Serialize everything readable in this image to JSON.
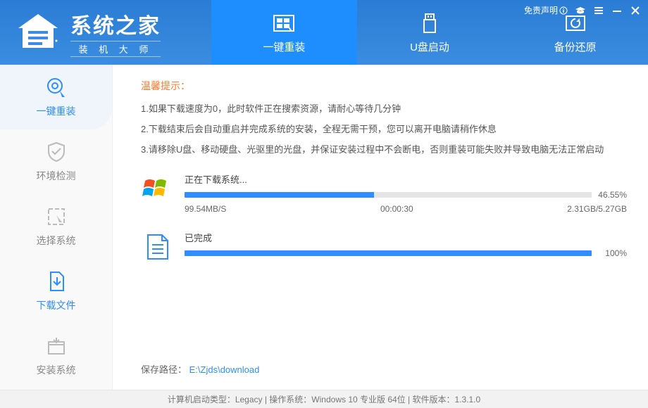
{
  "header": {
    "logo_title": "系统之家",
    "logo_subtitle": "装 机 大 师",
    "tabs": [
      {
        "label": "一键重装"
      },
      {
        "label": "U盘启动"
      },
      {
        "label": "备份还原"
      }
    ],
    "disclaimer": "免责声明"
  },
  "sidebar": {
    "items": [
      {
        "label": "一键重装"
      },
      {
        "label": "环境检测"
      },
      {
        "label": "选择系统"
      },
      {
        "label": "下载文件"
      },
      {
        "label": "安装系统"
      }
    ]
  },
  "hints": {
    "title": "温馨提示：",
    "lines": [
      "1.如果下载速度为0，此时软件正在搜索资源，请耐心等待几分钟",
      "2.下载结束后会自动重启并完成系统的安装，全程无需干预，您可以离开电脑请稍作休息",
      "3.请移除U盘、移动硬盘、光驱里的光盘，并保证安装过程中不会断电，否则重装可能失败并导致电脑无法正常启动"
    ]
  },
  "download": {
    "label": "正在下载系统...",
    "percent": 46.55,
    "percent_text": "46.55%",
    "speed": "99.54MB/S",
    "elapsed": "00:00:30",
    "size": "2.31GB/5.27GB"
  },
  "completed": {
    "label": "已完成",
    "percent": 100,
    "percent_text": "100%"
  },
  "save": {
    "label": "保存路径：",
    "path": "E:\\Zjds\\download"
  },
  "footer": {
    "text": "计算机启动类型：Legacy | 操作系统：Windows 10 专业版 64位 | 软件版本：1.3.1.0"
  }
}
